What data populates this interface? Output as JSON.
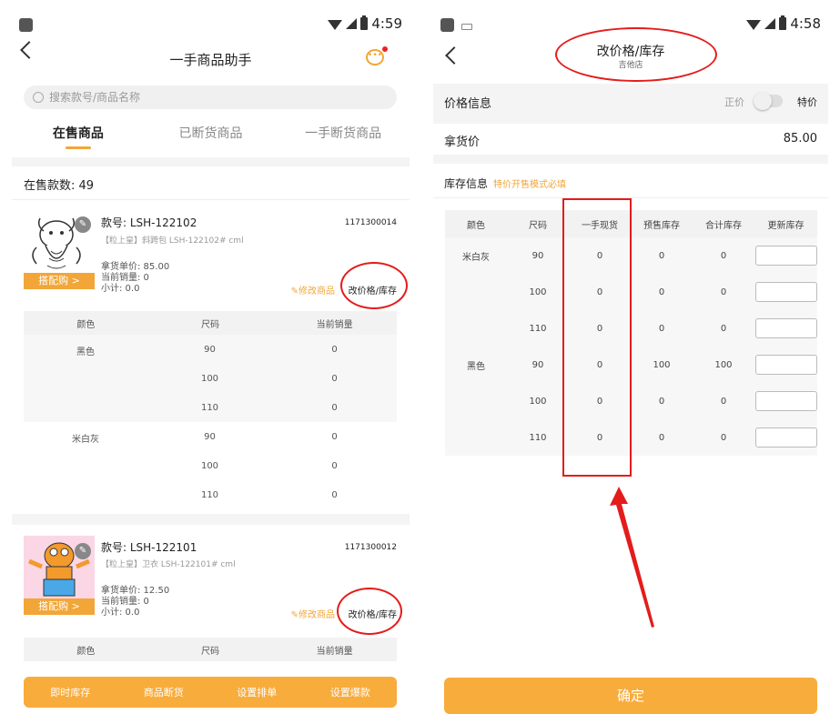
{
  "left": {
    "status": {
      "time": "4:59"
    },
    "nav": {
      "title": "一手商品助手",
      "chat_icon_text": "•••"
    },
    "search": {
      "placeholder": "搜索款号/商品名称"
    },
    "tabs": [
      "在售商品",
      "已断货商品",
      "一手断货商品"
    ],
    "count_label": "在售款数: 49",
    "products": [
      {
        "code": "款号: LSH-122102",
        "id": "1171300014",
        "desc": "【粒上皇】斜跨包 LSH-122102# cml",
        "price_line": "拿货单价: 85.00",
        "sales_line": "当前销量: 0",
        "subtotal_line": "小计: 0.0",
        "match_btn": "搭配购 >",
        "edit_link": "✎修改商品",
        "price_stock_btn": "改价格/库存",
        "table_headers": [
          "颜色",
          "尺码",
          "当前销量"
        ],
        "groups": [
          {
            "color": "黑色",
            "rows": [
              {
                "size": "90",
                "sales": "0"
              },
              {
                "size": "100",
                "sales": "0"
              },
              {
                "size": "110",
                "sales": "0"
              }
            ]
          },
          {
            "color": "米白灰",
            "rows": [
              {
                "size": "90",
                "sales": "0"
              },
              {
                "size": "100",
                "sales": "0"
              },
              {
                "size": "110",
                "sales": "0"
              }
            ]
          }
        ]
      },
      {
        "code": "款号: LSH-122101",
        "id": "1171300012",
        "desc": "【粒上皇】卫衣 LSH-122101# cml",
        "price_line": "拿货单价: 12.50",
        "sales_line": "当前销量: 0",
        "subtotal_line": "小计: 0.0",
        "match_btn": "搭配购 >",
        "edit_link": "✎修改商品",
        "price_stock_btn": "改价格/库存",
        "table_headers": [
          "颜色",
          "尺码",
          "当前销量"
        ]
      }
    ],
    "bottom_bar": [
      "即时库存",
      "商品断货",
      "设置排单",
      "设置爆款"
    ]
  },
  "right": {
    "status": {
      "time": "4:58"
    },
    "nav": {
      "title": "改价格/库存",
      "subtitle": "吉他店"
    },
    "price_info": {
      "label": "价格信息",
      "toggle_left": "正价",
      "toggle_right": "特价"
    },
    "cost": {
      "label": "拿货价",
      "value": "85.00"
    },
    "stock_info": {
      "label": "库存信息",
      "warning": "特价开售模式必填"
    },
    "inv_headers": [
      "颜色",
      "尺码",
      "一手现货",
      "预售库存",
      "合计库存",
      "更新库存"
    ],
    "inv_colors": [
      "米白灰",
      "黑色"
    ],
    "inv_rows": [
      {
        "size": "90",
        "spot": "0",
        "presale": "0",
        "total": "0"
      },
      {
        "size": "100",
        "spot": "0",
        "presale": "0",
        "total": "0"
      },
      {
        "size": "110",
        "spot": "0",
        "presale": "0",
        "total": "0"
      },
      {
        "size": "90",
        "spot": "0",
        "presale": "100",
        "total": "100"
      },
      {
        "size": "100",
        "spot": "0",
        "presale": "0",
        "total": "0"
      },
      {
        "size": "110",
        "spot": "0",
        "presale": "0",
        "total": "0"
      }
    ],
    "confirm": "确定"
  },
  "colors": {
    "accent": "#f8ac3c",
    "annotation_red": "#e41c1c"
  }
}
